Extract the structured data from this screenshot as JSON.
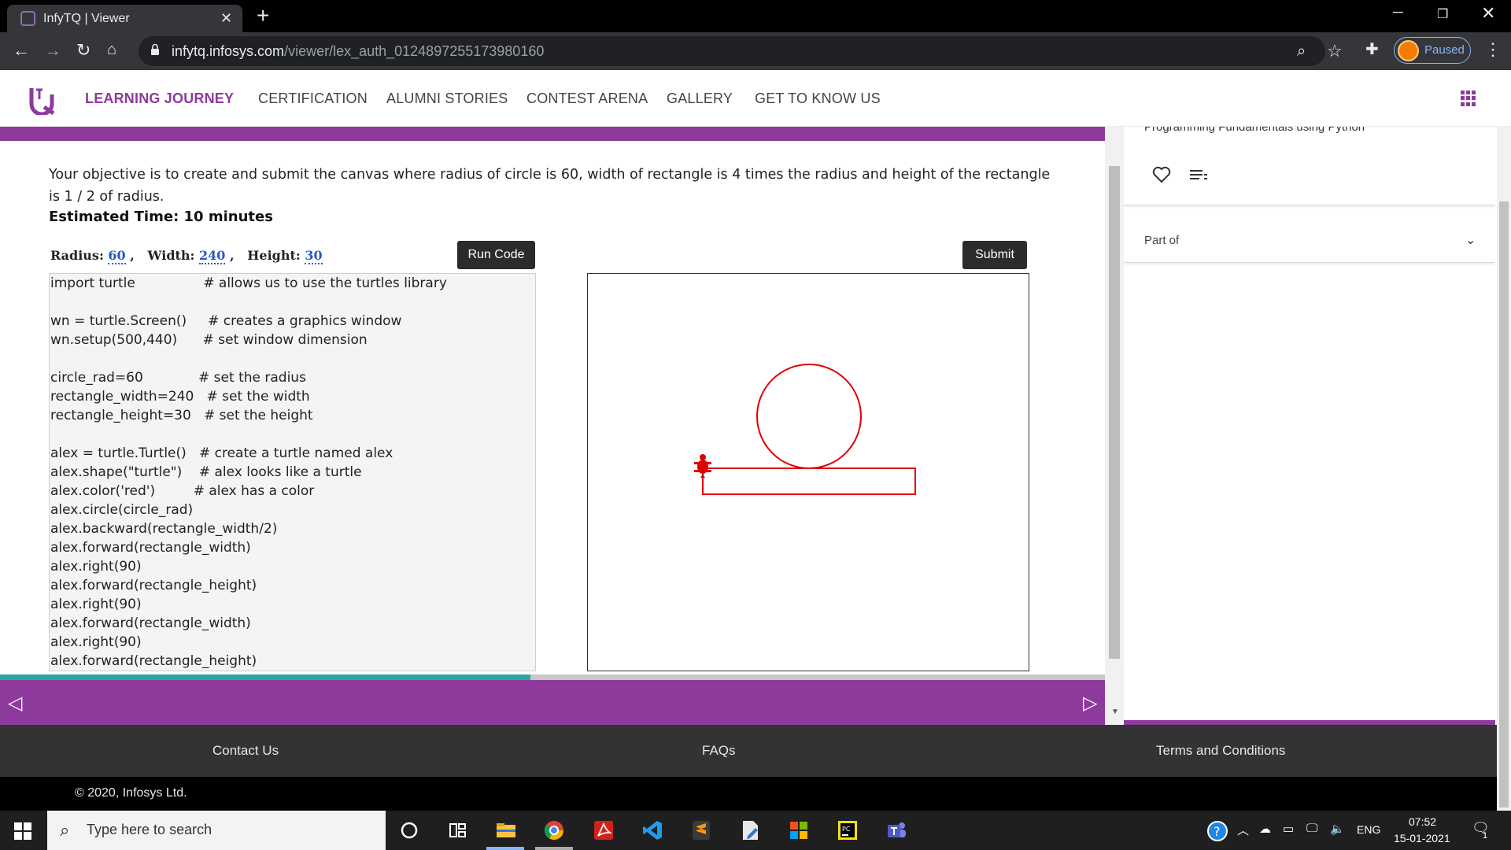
{
  "browser": {
    "tab_title": "InfyTQ | Viewer",
    "close_glyph": "✕",
    "new_tab_glyph": "+",
    "url_host": "infytq.infosys.com",
    "url_path": "/viewer/lex_auth_0124897255173980160",
    "profile_label": "Paused",
    "window_controls": [
      "─",
      "❐",
      "✕"
    ]
  },
  "site_nav": {
    "items": [
      "LEARNING JOURNEY",
      "CERTIFICATION",
      "ALUMNI STORIES",
      "CONTEST ARENA",
      "GALLERY",
      "GET TO KNOW US"
    ],
    "active_index": 0,
    "accent_color": "#8e3a9d"
  },
  "exercise": {
    "objective": "Your objective is to create and submit the canvas where radius of circle is 60, width of rectangle is 4 times the radius and height of the rectangle is 1 / 2 of radius.",
    "estimated_time": "Estimated Time: 10 minutes",
    "params": {
      "radius_label": "Radius:",
      "radius_value": "60",
      "width_label": "Width:",
      "width_value": "240",
      "height_label": "Height:",
      "height_value": "30"
    },
    "run_label": "Run Code",
    "submit_label": "Submit",
    "code_lines": [
      "import turtle                # allows us to use the turtles library",
      "",
      "wn = turtle.Screen()     # creates a graphics window",
      "wn.setup(500,440)      # set window dimension",
      "",
      "circle_rad=60             # set the radius",
      "rectangle_width=240   # set the width",
      "rectangle_height=30   # set the height",
      "",
      "alex = turtle.Turtle()   # create a turtle named alex",
      "alex.shape(\"turtle\")    # alex looks like a turtle",
      "alex.color('red')         # alex has a color",
      "alex.circle(circle_rad)",
      "alex.backward(rectangle_width/2)",
      "alex.forward(rectangle_width)",
      "alex.right(90)",
      "alex.forward(rectangle_height)",
      "alex.right(90)",
      "alex.forward(rectangle_width)",
      "alex.right(90)",
      "alex.forward(rectangle_height)"
    ],
    "drawing_color": "#e00000",
    "progress_fraction": 0.48,
    "prev_glyph": "◁",
    "next_glyph": "▷"
  },
  "right_panel": {
    "course_title": "Programming Fundamentals using Python",
    "more_glyph": "· ·",
    "part_of_label": "Part of",
    "chevron_glyph": "⌄"
  },
  "footer": {
    "links": [
      "Contact Us",
      "FAQs",
      "Terms and Conditions"
    ],
    "copyright": "© 2020, Infosys Ltd."
  },
  "taskbar": {
    "search_placeholder": "Type here to search",
    "lang": "ENG",
    "time": "07:52",
    "date": "15-01-2021",
    "notification_count": "1"
  }
}
